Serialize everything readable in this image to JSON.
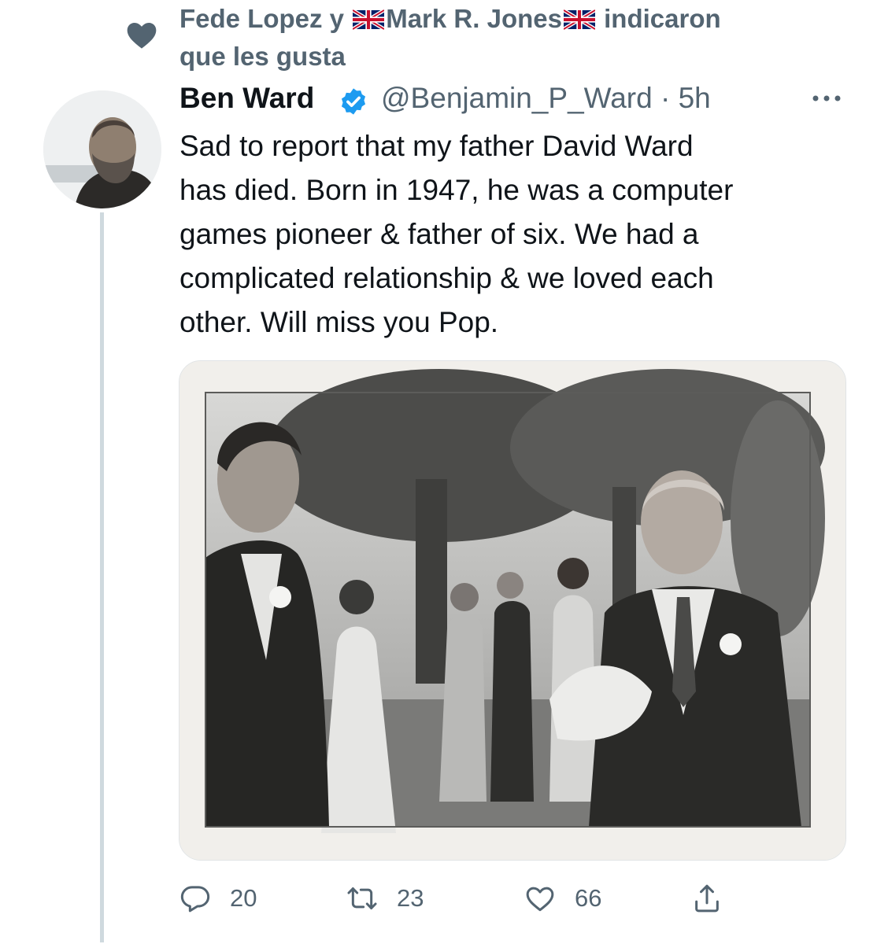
{
  "social_context": {
    "text_line1": "Fede Lopez y ",
    "name2": "Mark R. Jones",
    "text_line1_end": " indicaron",
    "text_line2": "que les gusta"
  },
  "tweet": {
    "author_name": "Ben Ward",
    "author_handle": "@Benjamin_P_Ward",
    "separator": "·",
    "time": "5h",
    "text": "Sad to report that my father David Ward\nhas died. Born in 1947, he was a computer\ngames pioneer & father of six. We had a\ncomplicated relationship & we loved each\nother. Will miss you Pop."
  },
  "actions": {
    "replies": "20",
    "retweets": "23",
    "likes": "66"
  },
  "icons": {
    "social_heart": "heart-icon",
    "verified": "verified-badge-icon",
    "more": "more-icon",
    "reply": "reply-icon",
    "retweet": "retweet-icon",
    "like": "like-icon",
    "share": "share-icon",
    "flag": "uk-flag-icon"
  },
  "colors": {
    "text_primary": "#0f1419",
    "text_secondary": "#536471",
    "verified_blue": "#1d9bf0",
    "thread_line": "#cfd9de"
  }
}
